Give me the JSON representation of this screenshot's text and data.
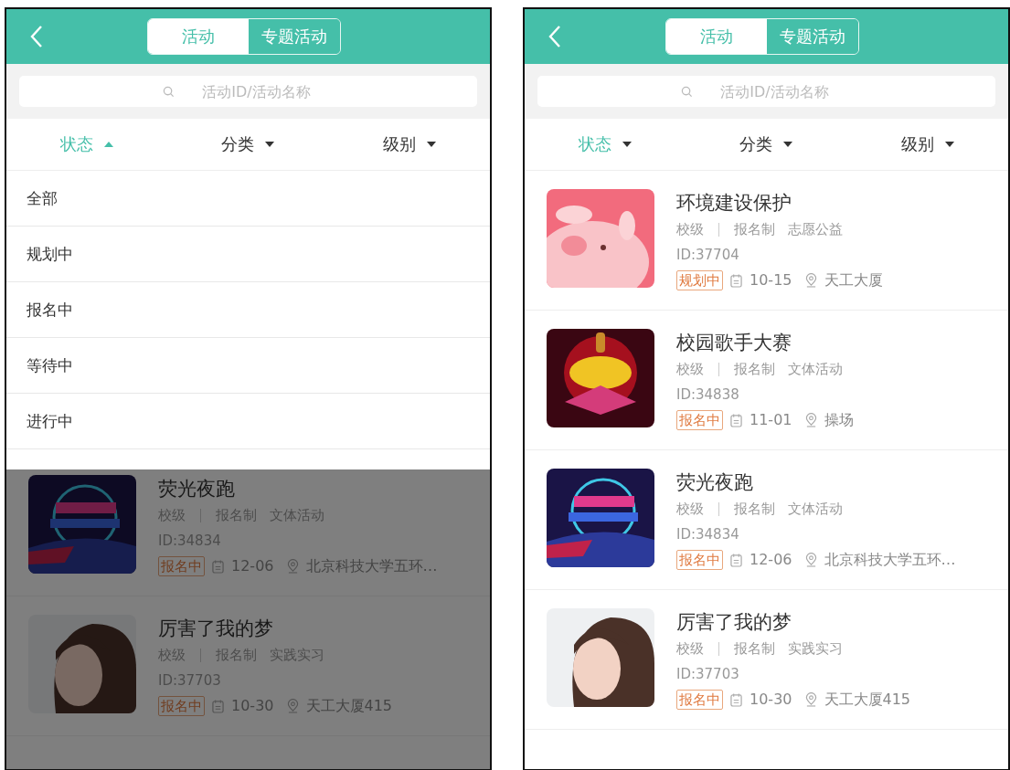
{
  "screens": [
    {
      "tabs": [
        {
          "label": "活动",
          "selected": true
        },
        {
          "label": "专题活动",
          "selected": false
        }
      ],
      "search": {
        "placeholder": "活动ID/活动名称"
      },
      "filters": [
        {
          "label": "状态",
          "active": true,
          "expanded": true
        },
        {
          "label": "分类",
          "active": false,
          "expanded": false
        },
        {
          "label": "级别",
          "active": false,
          "expanded": false
        }
      ],
      "dropdown": {
        "open": true,
        "options": [
          "全部",
          "规划中",
          "报名中",
          "等待中",
          "进行中"
        ]
      },
      "activities": [
        {
          "title": "荧光夜跑",
          "level": "校级",
          "signup": "报名制",
          "category": "文体活动",
          "id": "ID:34834",
          "status": "报名中",
          "date": "12-06",
          "place": "北京科技大学五环…"
        },
        {
          "title": "厉害了我的梦",
          "level": "校级",
          "signup": "报名制",
          "category": "实践实习",
          "id": "ID:37703",
          "status": "报名中",
          "date": "10-30",
          "place": "天工大厦415"
        }
      ]
    },
    {
      "tabs": [
        {
          "label": "活动",
          "selected": true
        },
        {
          "label": "专题活动",
          "selected": false
        }
      ],
      "search": {
        "placeholder": "活动ID/活动名称"
      },
      "filters": [
        {
          "label": "状态",
          "active": true,
          "expanded": false
        },
        {
          "label": "分类",
          "active": false,
          "expanded": false
        },
        {
          "label": "级别",
          "active": false,
          "expanded": false
        }
      ],
      "activities": [
        {
          "title": "环境建设保护",
          "level": "校级",
          "signup": "报名制",
          "category": "志愿公益",
          "id": "ID:37704",
          "status": "规划中",
          "date": "10-15",
          "place": "天工大厦"
        },
        {
          "title": "校园歌手大赛",
          "level": "校级",
          "signup": "报名制",
          "category": "文体活动",
          "id": "ID:34838",
          "status": "报名中",
          "date": "11-01",
          "place": "操场"
        },
        {
          "title": "荧光夜跑",
          "level": "校级",
          "signup": "报名制",
          "category": "文体活动",
          "id": "ID:34834",
          "status": "报名中",
          "date": "12-06",
          "place": "北京科技大学五环…"
        },
        {
          "title": "厉害了我的梦",
          "level": "校级",
          "signup": "报名制",
          "category": "实践实习",
          "id": "ID:37703",
          "status": "报名中",
          "date": "10-30",
          "place": "天工大厦415"
        }
      ]
    }
  ]
}
